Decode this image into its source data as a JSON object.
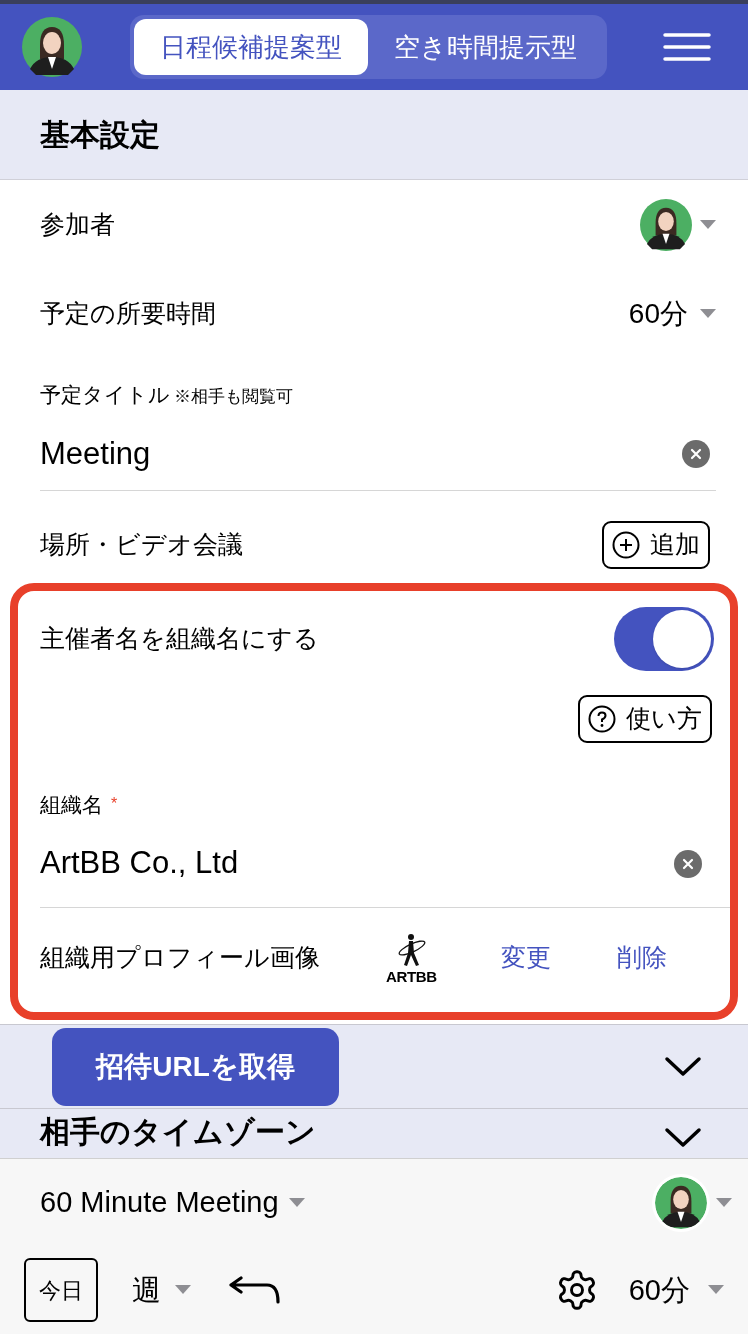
{
  "header": {
    "tabs": [
      {
        "label": "日程候補提案型",
        "selected": true
      },
      {
        "label": "空き時間提示型",
        "selected": false
      }
    ]
  },
  "basic_settings": {
    "title": "基本設定",
    "participants": {
      "label": "参加者"
    },
    "duration": {
      "label": "予定の所要時間",
      "value": "60分"
    },
    "event_title": {
      "label": "予定タイトル",
      "note": "※相手も閲覧可",
      "value": "Meeting"
    },
    "location": {
      "label": "場所・ビデオ会議",
      "add_button": "追加"
    },
    "organizer_as_org": {
      "label": "主催者名を組織名にする",
      "on": true,
      "help_button": "使い方"
    },
    "org_name": {
      "label": "組織名",
      "required_mark": "*",
      "value": "ArtBB Co., Ltd"
    },
    "org_image": {
      "label": "組織用プロフィール画像",
      "logo_text": "ARTBB",
      "change": "変更",
      "delete": "削除"
    }
  },
  "collapsed_sections": [
    {
      "expanded": false
    },
    {
      "title": "相手のタイムゾーン",
      "expanded": false
    }
  ],
  "invite_button": "招待URLを取得",
  "footer": {
    "event_type": "60 Minute Meeting",
    "today": "今日",
    "view": "週",
    "duration": "60分"
  }
}
